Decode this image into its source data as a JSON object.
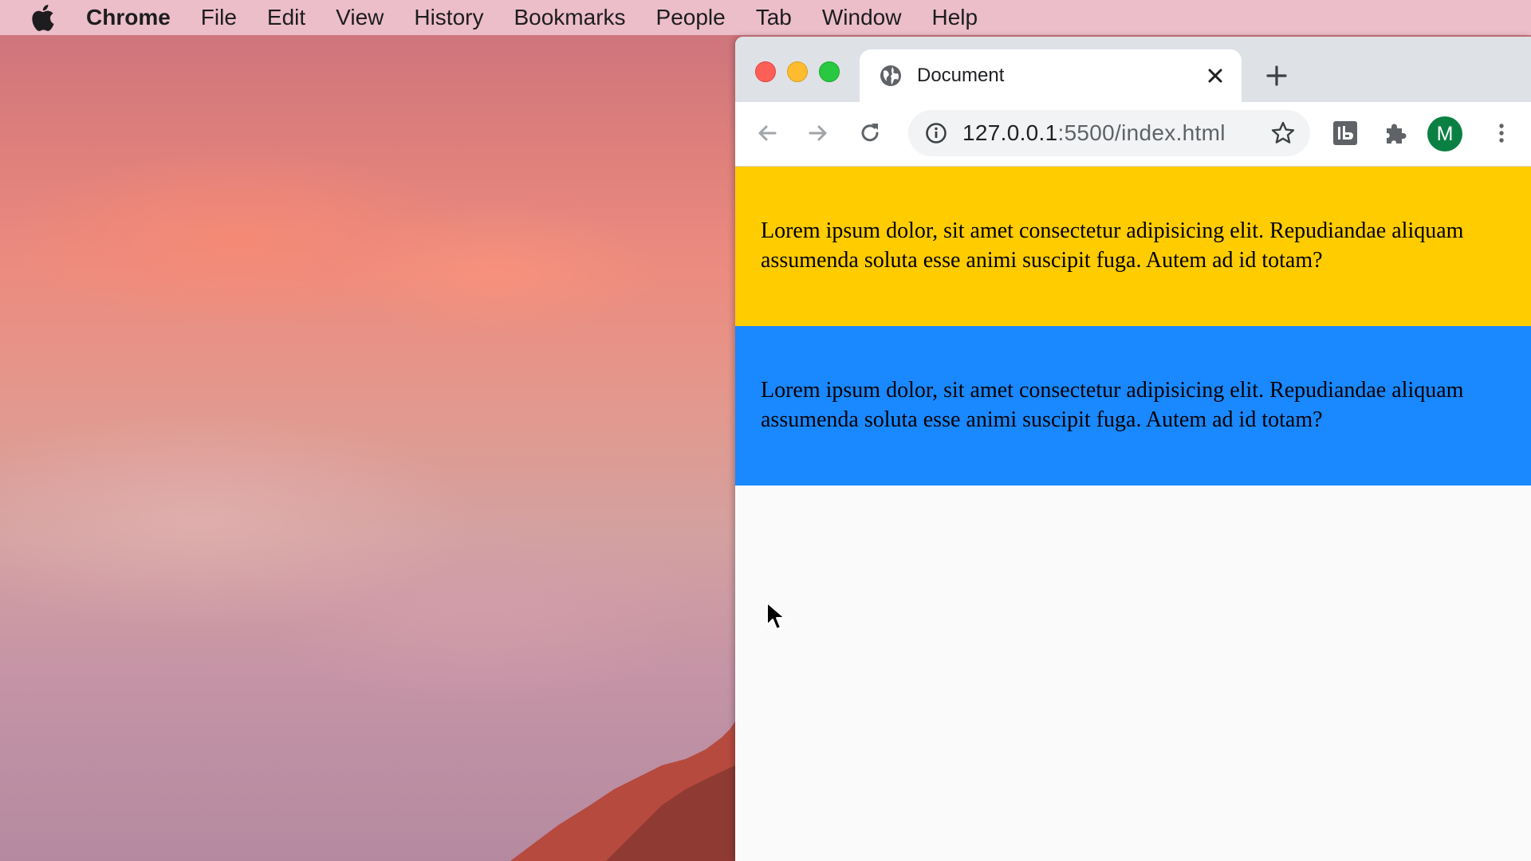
{
  "menubar": {
    "app_name": "Chrome",
    "items": [
      "File",
      "Edit",
      "View",
      "History",
      "Bookmarks",
      "People",
      "Tab",
      "Window",
      "Help"
    ]
  },
  "browser": {
    "tab": {
      "title": "Document"
    },
    "omnibox": {
      "url_host": "127.0.0.1",
      "url_rest": ":5500/index.html"
    },
    "profile": {
      "initial": "M",
      "color": "#0b8043"
    }
  },
  "page": {
    "paragraphs": [
      {
        "text": "Lorem ipsum dolor, sit amet consectetur adipisicing elit. Repudiandae aliquam assumenda soluta esse animi suscipit fuga. Autem ad id totam?",
        "background": "#ffcc00"
      },
      {
        "text": "Lorem ipsum dolor, sit amet consectetur adipisicing elit. Repudiandae aliquam assumenda soluta esse animi suscipit fuga. Autem ad id totam?",
        "background": "#1a88ff"
      }
    ]
  },
  "icons": {
    "apple": "apple-logo-icon",
    "tab_favicon": "globe-icon",
    "back": "arrow-left-icon",
    "forward": "arrow-right-icon",
    "reload": "reload-icon",
    "site_info": "info-icon",
    "bookmark": "star-icon",
    "extension_1": "extension-icon",
    "extensions": "puzzle-icon",
    "menu": "kebab-menu-icon"
  }
}
